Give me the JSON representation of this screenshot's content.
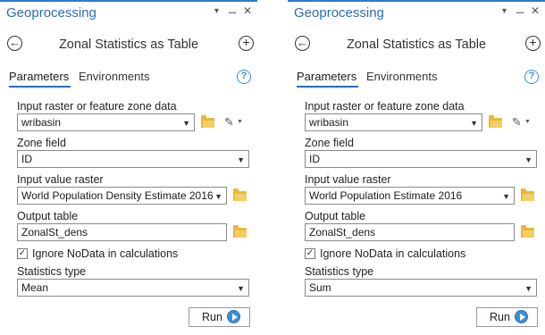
{
  "panes": [
    {
      "title": "Geoprocessing",
      "tool_name": "Zonal Statistics as Table",
      "tabs": [
        "Parameters",
        "Environments"
      ],
      "params": {
        "zone_data_label": "Input raster or feature zone data",
        "zone_data_value": "wribasin",
        "zone_field_label": "Zone field",
        "zone_field_value": "ID",
        "value_raster_label": "Input value raster",
        "value_raster_value": "World Population Density Estimate 2016",
        "output_table_label": "Output table",
        "output_table_value": "ZonalSt_dens",
        "ignore_nodata_label": "Ignore NoData in calculations",
        "ignore_nodata_checked": true,
        "stats_type_label": "Statistics type",
        "stats_type_value": "Mean"
      },
      "run_label": "Run"
    },
    {
      "title": "Geoprocessing",
      "tool_name": "Zonal Statistics as Table",
      "tabs": [
        "Parameters",
        "Environments"
      ],
      "params": {
        "zone_data_label": "Input raster or feature zone data",
        "zone_data_value": "wribasin",
        "zone_field_label": "Zone field",
        "zone_field_value": "ID",
        "value_raster_label": "Input value raster",
        "value_raster_value": "World Population Estimate 2016",
        "output_table_label": "Output table",
        "output_table_value": "ZonalSt_dens",
        "ignore_nodata_label": "Ignore NoData in calculations",
        "ignore_nodata_checked": true,
        "stats_type_label": "Statistics type",
        "stats_type_value": "Sum"
      },
      "run_label": "Run"
    }
  ],
  "icons": {
    "back": "back-arrow-icon",
    "add": "add-icon",
    "help": "help-icon",
    "folder": "folder-icon",
    "pencil": "pencil-icon",
    "run": "run-play-icon"
  },
  "colors": {
    "accent": "#2b6cb5",
    "folder": "#e8b83a",
    "run_play": "#3d8fd4"
  }
}
